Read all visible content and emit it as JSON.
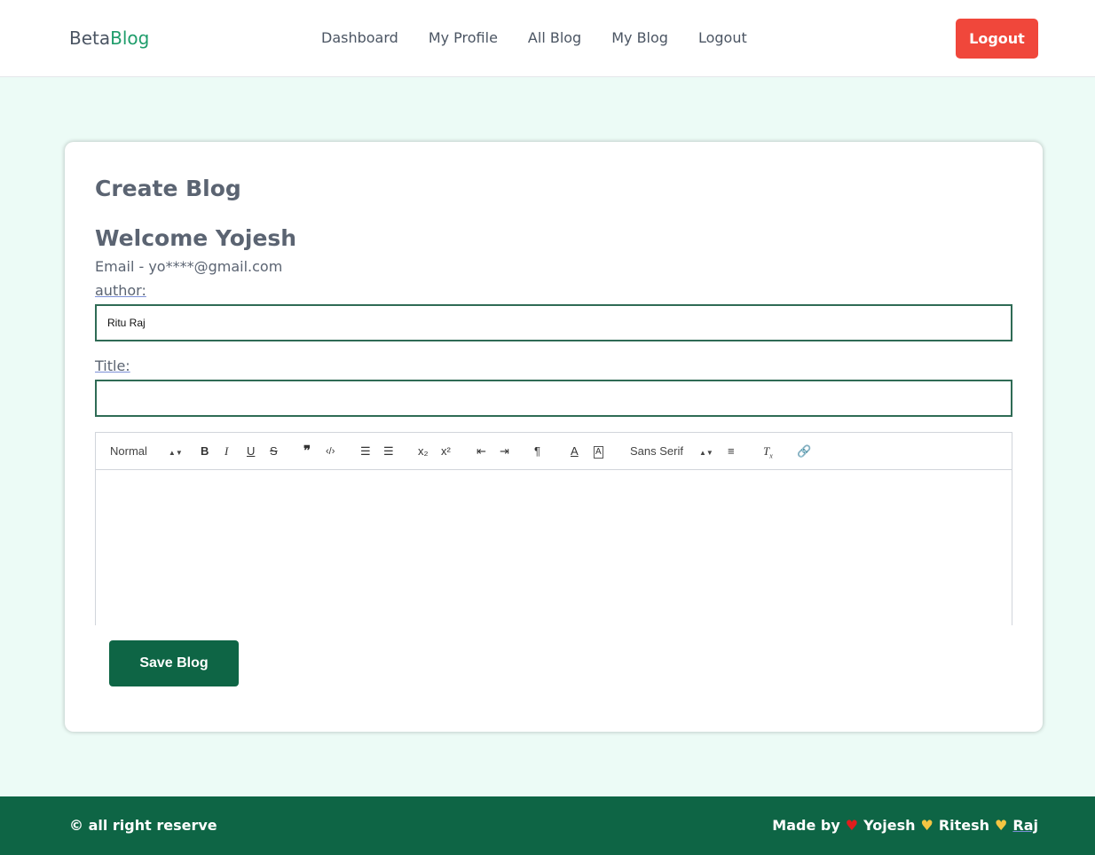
{
  "header": {
    "brand_part1": "Beta",
    "brand_part2": "Blog",
    "nav": [
      "Dashboard",
      "My Profile",
      "All Blog",
      "My Blog",
      "Logout"
    ],
    "logout_button": "Logout"
  },
  "form": {
    "page_title": "Create Blog",
    "welcome": "Welcome Yojesh",
    "email": "Email - yo****@gmail.com",
    "author_label": "author:",
    "author_value": "Ritu Raj",
    "title_label": "Title:",
    "title_value": "",
    "toolbar": {
      "header_select": "Normal",
      "font_select": "Sans Serif"
    },
    "save_button": "Save Blog"
  },
  "footer": {
    "copyright": "© all right reserve",
    "made_by": "Made by",
    "authors": [
      "Yojesh",
      "Ritesh",
      "Raj"
    ]
  },
  "colors": {
    "brand_accent": "#1f9d6b",
    "logout": "#f0473b",
    "primary": "#0e6545",
    "page_bg": "#ecfbf6"
  }
}
